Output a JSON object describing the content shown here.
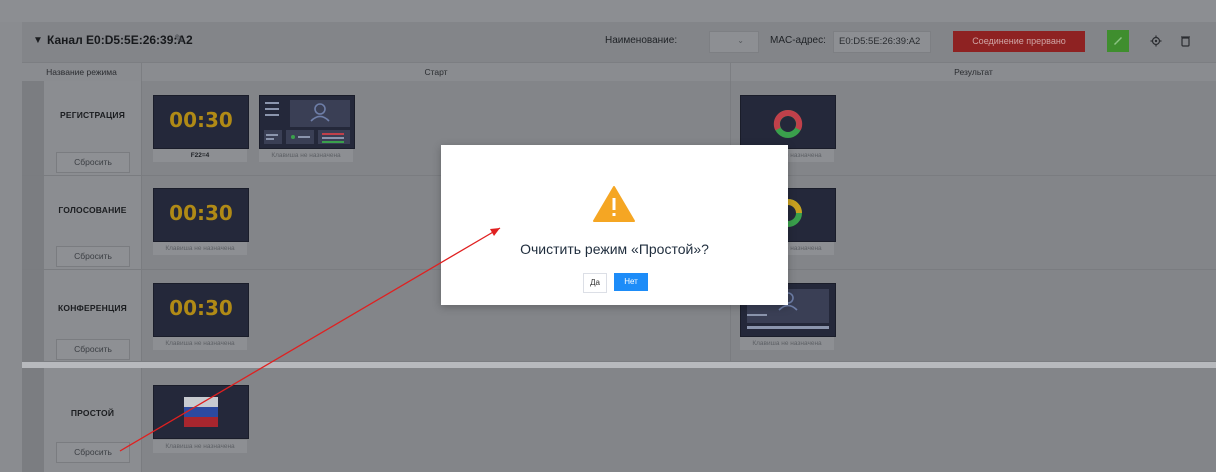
{
  "header": {
    "title": "Канал E0:D5:5E:26:39:A2",
    "name_label": "Наименование:",
    "name_value": "",
    "mac_label": "MAC-адрес:",
    "mac_value": "E0:D5:5E:26:39:A2",
    "status": "Соединение прервано"
  },
  "table": {
    "col_name": "Название режима",
    "col_start": "Старт",
    "col_result": "Результат"
  },
  "rows": [
    {
      "name": "РЕГИСТРАЦИЯ",
      "reset": "Сбросить",
      "timer": "00:30",
      "start_caption_1": "F22=4",
      "start_caption_2": "Клавиша не назначена",
      "result_caption": "Клавиша не назначена"
    },
    {
      "name": "ГОЛОСОВАНИЕ",
      "reset": "Сбросить",
      "timer": "00:30",
      "start_caption_1": "Клавиша не назначена",
      "result_caption": "Клавиша не назначена"
    },
    {
      "name": "КОНФЕРЕНЦИЯ",
      "reset": "Сбросить",
      "timer": "00:30",
      "start_caption_1": "Клавиша не назначена",
      "result_caption": "Клавиша не назначена"
    },
    {
      "name": "ПРОСТОЙ",
      "reset": "Сбросить",
      "start_caption_1": "Клавиша не назначена"
    }
  ],
  "dialog": {
    "message": "Очистить режим «Простой»?",
    "yes": "Да",
    "no": "Нет"
  },
  "colors": {
    "status_bg": "#8e2222",
    "primary": "#1d8cf8",
    "warning": "#f5a623",
    "annotation": "#e02020"
  }
}
